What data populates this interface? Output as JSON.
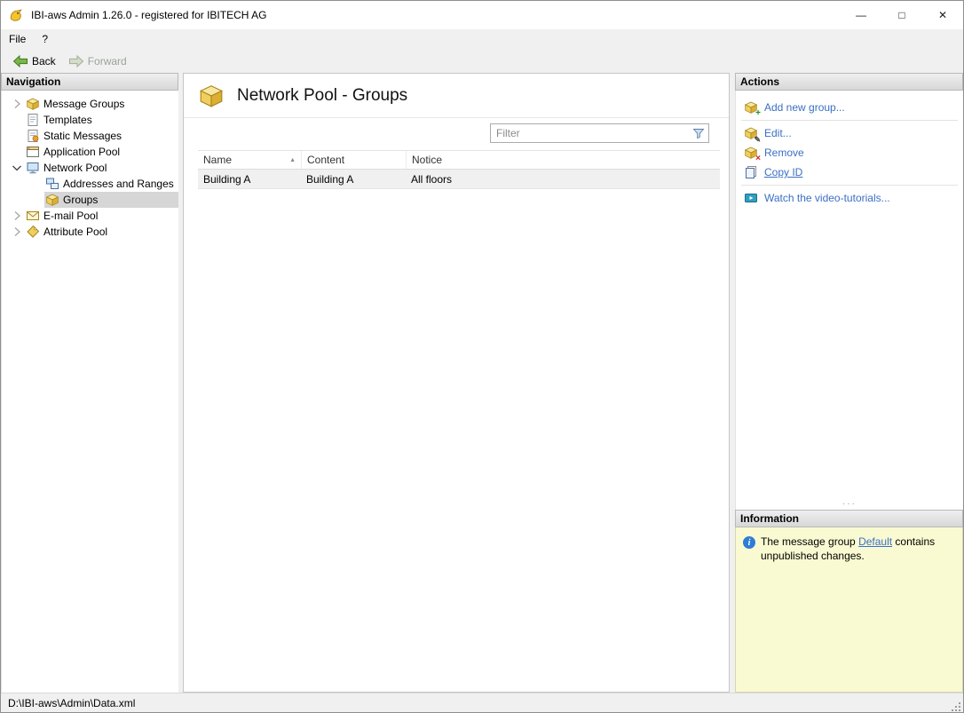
{
  "window": {
    "title": "IBI-aws Admin 1.26.0 - registered for IBITECH AG",
    "controls": {
      "minimize": "—",
      "maximize": "□",
      "close": "✕"
    }
  },
  "menu": {
    "items": [
      {
        "label": "File"
      },
      {
        "label": "?"
      }
    ]
  },
  "toolbar": {
    "back_label": "Back",
    "forward_label": "Forward"
  },
  "navigation": {
    "header": "Navigation",
    "items": [
      {
        "label": "Message Groups",
        "expandable": true,
        "expanded": false
      },
      {
        "label": "Templates"
      },
      {
        "label": "Static Messages"
      },
      {
        "label": "Application Pool"
      },
      {
        "label": "Network Pool",
        "expandable": true,
        "expanded": true
      },
      {
        "label": "Addresses and Ranges",
        "level": 1
      },
      {
        "label": "Groups",
        "level": 1,
        "selected": true
      },
      {
        "label": "E-mail Pool",
        "expandable": true,
        "expanded": false
      },
      {
        "label": "Attribute Pool",
        "expandable": true,
        "expanded": false
      }
    ]
  },
  "main": {
    "title": "Network Pool - Groups",
    "filter_placeholder": "Filter",
    "table": {
      "columns": [
        {
          "label": "Name",
          "sort": "asc",
          "sort_glyph": "▲"
        },
        {
          "label": "Content"
        },
        {
          "label": "Notice"
        }
      ],
      "rows": [
        {
          "name": "Building A",
          "content": "Building A",
          "notice": "All floors"
        }
      ]
    }
  },
  "actions": {
    "header": "Actions",
    "items": [
      {
        "label": "Add new group..."
      },
      {
        "label": "Edit..."
      },
      {
        "label": "Remove"
      },
      {
        "label": "Copy ID"
      },
      {
        "label": "Watch the video-tutorials..."
      }
    ],
    "splitter_dots": "···"
  },
  "information": {
    "header": "Information",
    "text_before": "The message group ",
    "link_label": "Default",
    "text_after": " contains unpublished changes."
  },
  "statusbar": {
    "path": "D:\\IBI-aws\\Admin\\Data.xml"
  }
}
